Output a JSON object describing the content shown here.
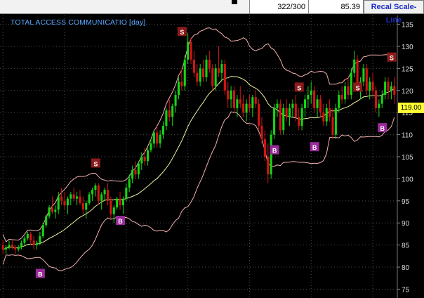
{
  "window": {
    "title": "TOTAL ACCESS COMMUNICATIO [day]",
    "count": "322/300",
    "price": "85.39",
    "recal_label": "Recal Scale-Line"
  },
  "colors": {
    "background": "#000000",
    "up_candle": "#14d614",
    "down_candle": "#d41414",
    "band": "#f3b1b1",
    "middle": "#f0f0a0",
    "signal_sell": "#8b1a1a",
    "signal_buy": "#9a2a9a",
    "grid": "#4a4a4a",
    "title": "#5aa7ff",
    "price_tag": "#ffff33",
    "button_text": "#1b2cc8"
  },
  "chart_data": {
    "type": "candlestick",
    "title": "TOTAL ACCESS COMMUNICATIO [day]",
    "ylim": [
      73,
      137
    ],
    "y_ticks": [
      75,
      80,
      85,
      90,
      95,
      100,
      105,
      110,
      115,
      120,
      125,
      130,
      135
    ],
    "grid": true,
    "last_price": "119.00",
    "ohlc": [
      [
        85,
        86,
        83,
        84
      ],
      [
        84,
        85,
        83,
        84.5
      ],
      [
        84.5,
        86,
        84,
        85
      ],
      [
        85,
        86,
        84,
        84.5
      ],
      [
        84.5,
        85,
        83,
        84
      ],
      [
        84,
        85,
        83.5,
        84.5
      ],
      [
        84.5,
        86,
        84,
        85.5
      ],
      [
        85.5,
        87,
        85,
        86.5
      ],
      [
        86.5,
        88,
        86,
        87.5
      ],
      [
        87.5,
        88,
        85,
        86
      ],
      [
        86,
        87,
        84,
        85
      ],
      [
        85,
        86,
        84,
        85.5
      ],
      [
        85.5,
        88,
        85,
        87
      ],
      [
        87,
        90,
        86.5,
        89.5
      ],
      [
        89.5,
        92,
        89,
        91.5
      ],
      [
        91.5,
        94,
        91,
        93.5
      ],
      [
        93.5,
        96,
        92,
        92.5
      ],
      [
        92.5,
        94,
        91,
        93
      ],
      [
        93,
        97,
        92,
        96
      ],
      [
        96,
        98,
        94,
        95
      ],
      [
        95,
        97,
        93,
        94
      ],
      [
        94,
        96,
        92,
        95.5
      ],
      [
        95.5,
        97,
        94,
        96.5
      ],
      [
        96.5,
        98,
        95,
        95.5
      ],
      [
        95.5,
        97,
        94,
        96
      ],
      [
        96,
        97.5,
        94,
        94.5
      ],
      [
        94.5,
        96,
        92,
        93
      ],
      [
        93,
        95,
        91,
        94.5
      ],
      [
        94.5,
        97,
        94,
        96.5
      ],
      [
        96.5,
        98,
        95,
        97.5
      ],
      [
        97.5,
        99,
        96,
        98.5
      ],
      [
        98.5,
        99,
        94,
        95
      ],
      [
        95,
        97,
        93,
        96.5
      ],
      [
        96.5,
        98,
        95,
        97.5
      ],
      [
        97.5,
        99,
        94,
        95
      ],
      [
        95,
        96,
        91,
        92
      ],
      [
        92,
        94,
        90,
        93.5
      ],
      [
        93.5,
        96,
        93,
        95.5
      ],
      [
        95.5,
        97,
        93,
        94
      ],
      [
        94,
        96,
        92,
        95.5
      ],
      [
        95.5,
        99,
        95,
        98
      ],
      [
        98,
        101,
        97,
        100
      ],
      [
        100,
        103,
        99,
        102
      ],
      [
        102,
        104,
        100,
        101
      ],
      [
        101,
        104,
        100,
        103.5
      ],
      [
        103.5,
        106,
        102,
        105
      ],
      [
        105,
        107,
        103,
        104
      ],
      [
        104,
        107,
        103,
        106.5
      ],
      [
        106.5,
        109,
        106,
        108
      ],
      [
        108,
        111,
        107,
        110.5
      ],
      [
        110.5,
        112,
        107,
        108
      ],
      [
        108,
        111,
        107,
        110
      ],
      [
        110,
        113,
        109,
        112
      ],
      [
        112,
        116,
        111,
        115.5
      ],
      [
        115.5,
        118,
        113,
        114
      ],
      [
        114,
        117,
        112,
        116.5
      ],
      [
        116.5,
        120,
        115,
        119
      ],
      [
        119,
        123,
        118,
        122
      ],
      [
        122,
        125,
        120,
        121
      ],
      [
        121,
        128,
        120,
        127
      ],
      [
        127,
        133,
        126,
        131
      ],
      [
        131,
        132,
        126,
        127
      ],
      [
        127,
        129,
        123,
        124
      ],
      [
        124,
        126,
        121,
        122
      ],
      [
        122,
        126,
        121,
        125
      ],
      [
        125,
        127,
        122,
        123
      ],
      [
        123,
        128,
        122,
        127
      ],
      [
        127,
        129,
        124,
        125
      ],
      [
        125,
        126,
        120,
        121
      ],
      [
        121,
        126,
        120,
        125
      ],
      [
        125,
        130,
        123,
        124
      ],
      [
        124,
        127,
        122,
        126
      ],
      [
        126,
        127,
        119,
        120
      ],
      [
        120,
        122,
        116,
        118
      ],
      [
        118,
        121,
        116,
        120
      ],
      [
        120,
        121,
        115,
        116
      ],
      [
        116,
        119,
        114,
        118
      ],
      [
        118,
        121,
        116,
        117
      ],
      [
        117,
        119,
        114,
        115
      ],
      [
        115,
        118,
        113,
        117
      ],
      [
        117,
        119,
        115,
        116
      ],
      [
        116,
        119,
        114,
        118.5
      ],
      [
        118.5,
        120,
        116,
        117
      ],
      [
        117,
        118,
        111,
        112
      ],
      [
        112,
        114,
        108,
        109
      ],
      [
        109,
        111,
        104,
        105
      ],
      [
        105,
        108,
        99,
        101
      ],
      [
        101,
        111,
        100,
        110
      ],
      [
        110,
        117,
        109,
        116
      ],
      [
        116,
        118,
        114,
        117
      ],
      [
        117,
        118,
        110,
        111
      ],
      [
        111,
        117,
        110,
        116
      ],
      [
        116,
        118,
        113,
        114
      ],
      [
        114,
        117,
        112,
        116
      ],
      [
        116,
        118,
        114,
        117
      ],
      [
        117,
        119,
        113,
        114
      ],
      [
        114,
        116,
        111,
        112
      ],
      [
        112,
        117,
        111,
        116
      ],
      [
        116,
        119,
        114,
        118
      ],
      [
        118,
        121,
        116,
        119
      ],
      [
        119,
        122,
        117,
        120
      ],
      [
        120,
        121,
        115,
        116
      ],
      [
        116,
        119,
        114,
        118
      ],
      [
        118,
        119,
        114,
        115
      ],
      [
        115,
        117,
        112,
        113
      ],
      [
        113,
        117,
        112,
        116
      ],
      [
        116,
        118,
        113,
        114
      ],
      [
        114,
        116,
        109,
        110
      ],
      [
        110,
        117,
        109,
        116
      ],
      [
        116,
        120,
        115,
        119
      ],
      [
        119,
        121,
        117,
        118
      ],
      [
        118,
        122,
        117,
        121
      ],
      [
        121,
        123,
        118,
        119
      ],
      [
        119,
        125,
        118,
        124
      ],
      [
        124,
        129,
        123,
        127
      ],
      [
        127,
        128,
        120,
        121
      ],
      [
        121,
        123,
        118,
        122
      ],
      [
        122,
        126,
        121,
        125
      ],
      [
        125,
        126,
        119,
        120
      ],
      [
        120,
        123,
        118,
        122
      ],
      [
        122,
        124,
        119,
        120
      ],
      [
        120,
        121,
        115,
        116
      ],
      [
        116,
        118,
        114,
        117
      ],
      [
        117,
        120,
        116,
        119
      ],
      [
        119,
        123,
        118,
        122
      ],
      [
        122,
        123,
        118,
        120
      ],
      [
        120,
        122,
        118,
        121
      ],
      [
        121,
        123,
        117,
        119
      ]
    ],
    "signals": [
      {
        "label": "B",
        "bar": 12,
        "y": 78.5
      },
      {
        "label": "S",
        "bar": 30,
        "y": 103.5
      },
      {
        "label": "B",
        "bar": 38,
        "y": 90.5
      },
      {
        "label": "S",
        "bar": 58,
        "y": 133.3
      },
      {
        "label": "B",
        "bar": 88,
        "y": 106.5
      },
      {
        "label": "S",
        "bar": 96,
        "y": 120.7
      },
      {
        "label": "B",
        "bar": 101,
        "y": 107.2
      },
      {
        "label": "S",
        "bar": 115,
        "y": 120.7
      },
      {
        "label": "B",
        "bar": 123,
        "y": 111.5
      },
      {
        "label": "S",
        "bar": 126,
        "y": 127.5
      }
    ]
  }
}
